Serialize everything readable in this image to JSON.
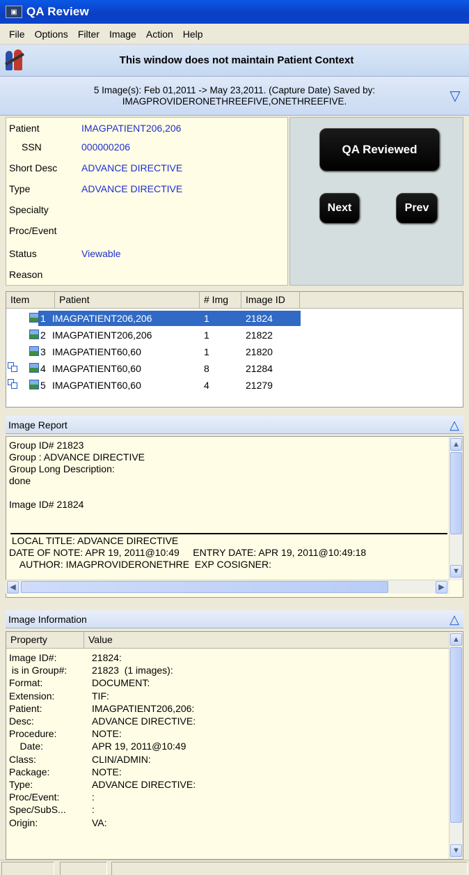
{
  "window": {
    "title": "QA Review"
  },
  "menu": [
    "File",
    "Options",
    "Filter",
    "Image",
    "Action",
    "Help"
  ],
  "context_bar": {
    "text": "This window does not maintain Patient Context"
  },
  "summary": {
    "line1": "5 Image(s): Feb 01,2011 -> May 23,2011. (Capture Date) Saved by:",
    "line2": "IMAGPROVIDERONETHREEFIVE,ONETHREEFIVE."
  },
  "details": [
    {
      "label": "Patient",
      "value": "IMAGPATIENT206,206"
    },
    {
      "label": "SSN",
      "value": "000000206"
    },
    {
      "label": "Short Desc",
      "value": "ADVANCE DIRECTIVE"
    },
    {
      "label": "Type",
      "value": "ADVANCE DIRECTIVE"
    },
    {
      "label": "Specialty",
      "value": ""
    },
    {
      "label": "Proc/Event",
      "value": ""
    },
    {
      "label": "Status",
      "value": "Viewable"
    },
    {
      "label": "Reason",
      "value": ""
    }
  ],
  "actions": {
    "qa_reviewed": "QA Reviewed",
    "next": "Next",
    "prev": "Prev"
  },
  "image_list": {
    "columns": [
      "Item",
      "Patient",
      "# Img",
      "Image ID"
    ],
    "rows": [
      {
        "item": "1",
        "patient": "IMAGPATIENT206,206",
        "num_img": "1",
        "image_id": "21824",
        "selected": true,
        "group": false
      },
      {
        "item": "2",
        "patient": "IMAGPATIENT206,206",
        "num_img": "1",
        "image_id": "21822",
        "selected": false,
        "group": false
      },
      {
        "item": "3",
        "patient": "IMAGPATIENT60,60",
        "num_img": "1",
        "image_id": "21820",
        "selected": false,
        "group": false
      },
      {
        "item": "4",
        "patient": "IMAGPATIENT60,60",
        "num_img": "8",
        "image_id": "21284",
        "selected": false,
        "group": true
      },
      {
        "item": "5",
        "patient": "IMAGPATIENT60,60",
        "num_img": "4",
        "image_id": "21279",
        "selected": false,
        "group": true
      }
    ]
  },
  "image_report": {
    "title": "Image Report",
    "text_top": "Group ID# 21823\nGroup : ADVANCE DIRECTIVE\nGroup Long Description:\ndone\n\nImage ID# 21824",
    "text_bottom": " LOCAL TITLE: ADVANCE DIRECTIVE\nDATE OF NOTE: APR 19, 2011@10:49     ENTRY DATE: APR 19, 2011@10:49:18\n    AUTHOR: IMAGPROVIDERONETHRE  EXP COSIGNER:"
  },
  "image_information": {
    "title": "Image Information",
    "columns": [
      "Property",
      "Value"
    ],
    "rows": [
      {
        "property": "Image ID#:",
        "value": "21824:"
      },
      {
        "property": " is in Group#:",
        "value": "21823  (1 images):"
      },
      {
        "property": "Format:",
        "value": "DOCUMENT:"
      },
      {
        "property": "Extension:",
        "value": "TIF:"
      },
      {
        "property": "Patient:",
        "value": "IMAGPATIENT206,206:"
      },
      {
        "property": "Desc:",
        "value": "ADVANCE DIRECTIVE:"
      },
      {
        "property": "Procedure:",
        "value": "NOTE:"
      },
      {
        "property": "    Date:",
        "value": "APR 19, 2011@10:49"
      },
      {
        "property": "Class:",
        "value": "CLIN/ADMIN:"
      },
      {
        "property": "Package:",
        "value": "NOTE:"
      },
      {
        "property": "Type:",
        "value": "ADVANCE DIRECTIVE:"
      },
      {
        "property": "Proc/Event:",
        "value": ":"
      },
      {
        "property": "Spec/SubS...",
        "value": ":"
      },
      {
        "property": "Origin:",
        "value": "VA:"
      }
    ]
  },
  "colors": {
    "link_blue": "#1e2fd0",
    "selection": "#316ac5",
    "panel_yellow": "#fffde5"
  }
}
